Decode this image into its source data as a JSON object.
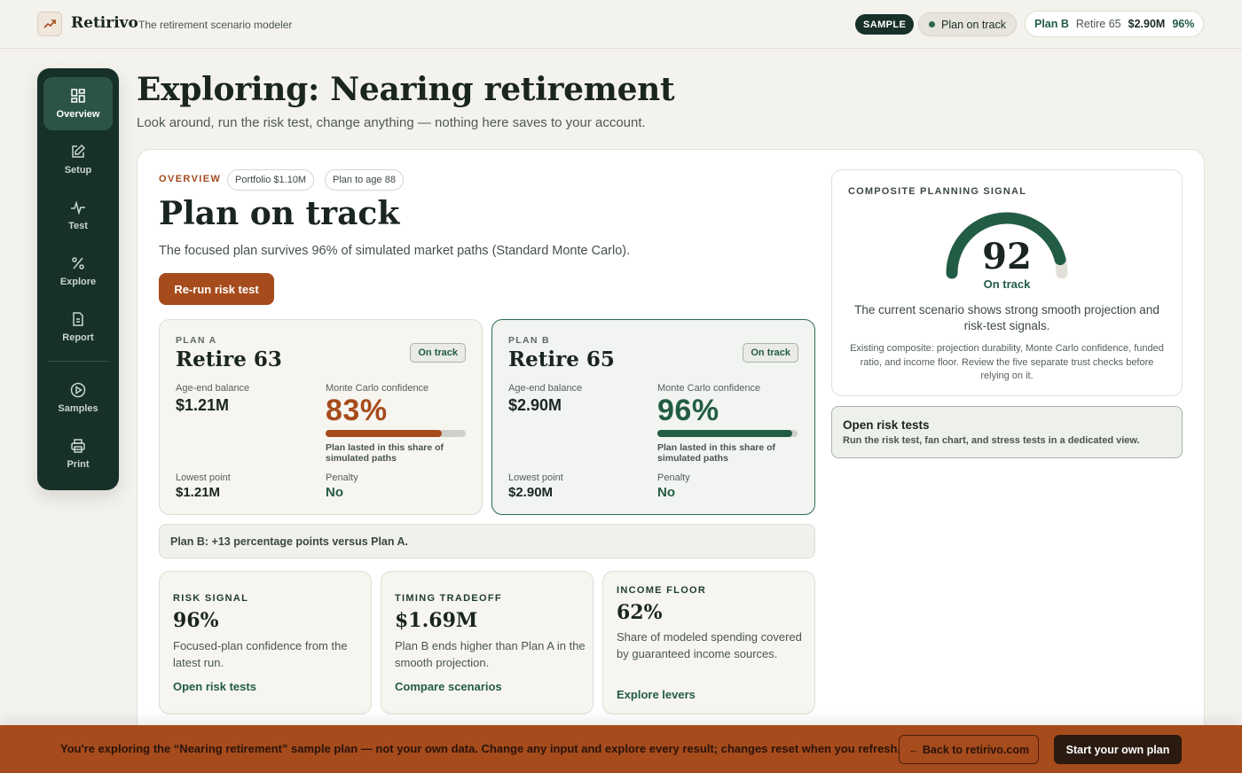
{
  "app": {
    "brand": "Retirivo",
    "tagline": "The retirement scenario modeler"
  },
  "header": {
    "sample_label": "SAMPLE",
    "status_label": "Plan on track",
    "plan_pill": {
      "plan": "Plan B",
      "retire": "Retire 65",
      "value": "$2.90M",
      "pct": "96%"
    }
  },
  "sidebar": {
    "items": [
      {
        "label": "Overview",
        "icon": "grid-icon",
        "active": true
      },
      {
        "label": "Setup",
        "icon": "edit-icon"
      },
      {
        "label": "Test",
        "icon": "pulse-icon"
      },
      {
        "label": "Explore",
        "icon": "percent-icon"
      },
      {
        "label": "Report",
        "icon": "document-icon"
      },
      {
        "label": "Samples",
        "icon": "play-circle-icon"
      },
      {
        "label": "Print",
        "icon": "printer-icon"
      }
    ]
  },
  "page": {
    "title": "Exploring: Nearing retirement",
    "subtitle": "Look around, run the risk test, change anything — nothing here saves to your account."
  },
  "overview": {
    "eyebrow": "OVERVIEW",
    "chips": [
      "Portfolio $1.10M",
      "Plan to age 88"
    ],
    "title": "Plan on track",
    "subtitle": "The focused plan survives 96% of simulated market paths (Standard Monte Carlo).",
    "rerun_label": "Re-run risk test"
  },
  "plans": [
    {
      "eyebrow": "PLAN A",
      "title": "Retire 63",
      "badge": "On track",
      "age_end_label": "Age-end balance",
      "age_end_value": "$1.21M",
      "mc_label": "Monte Carlo confidence",
      "mc_value": "83%",
      "mc_fraction": 0.83,
      "mc_color": "#a64b1c",
      "mc_note": "Plan lasted in this share of simulated paths",
      "lowest_label": "Lowest point",
      "lowest_value": "$1.21M",
      "penalty_label": "Penalty",
      "penalty_value": "No"
    },
    {
      "eyebrow": "PLAN B",
      "title": "Retire 65",
      "badge": "On track",
      "age_end_label": "Age-end balance",
      "age_end_value": "$2.90M",
      "mc_label": "Monte Carlo confidence",
      "mc_value": "96%",
      "mc_fraction": 0.96,
      "mc_color": "#235c45",
      "mc_note": "Plan lasted in this share of simulated paths",
      "lowest_label": "Lowest point",
      "lowest_value": "$2.90M",
      "penalty_label": "Penalty",
      "penalty_value": "No"
    }
  ],
  "comparison": "Plan B: +13 percentage points versus Plan A.",
  "insights": [
    {
      "eyebrow": "RISK SIGNAL",
      "value": "96%",
      "desc": "Focused-plan confidence from the latest run.",
      "link": "Open risk tests"
    },
    {
      "eyebrow": "TIMING TRADEOFF",
      "value": "$1.69M",
      "desc": "Plan B ends higher than Plan A in the smooth projection.",
      "link": "Compare scenarios"
    },
    {
      "eyebrow": "INCOME FLOOR",
      "value": "62%",
      "desc": "Share of modeled spending covered by guaranteed income sources.",
      "link": "Explore levers"
    }
  ],
  "signal": {
    "eyebrow": "COMPOSITE PLANNING SIGNAL",
    "score": "92",
    "score_fraction": 0.92,
    "score_label": "On track",
    "desc": "The current scenario shows strong smooth projection and risk-test signals.",
    "note": "Existing composite: projection durability, Monte Carlo confidence, funded ratio, and income floor. Review the five separate trust checks before relying on it.",
    "colors": {
      "arc": "#235c45",
      "track": "#e2e0d8"
    }
  },
  "risk_tests": {
    "title": "Open risk tests",
    "desc": "Run the risk test, fan chart, and stress tests in a dedicated view."
  },
  "banner": {
    "text": "You're exploring the “Nearing retirement” sample plan — not your own data. Change any input and explore every result; changes reset when you refresh.",
    "back_label": "← Back to retirivo.com",
    "start_label": "Start your own plan"
  }
}
